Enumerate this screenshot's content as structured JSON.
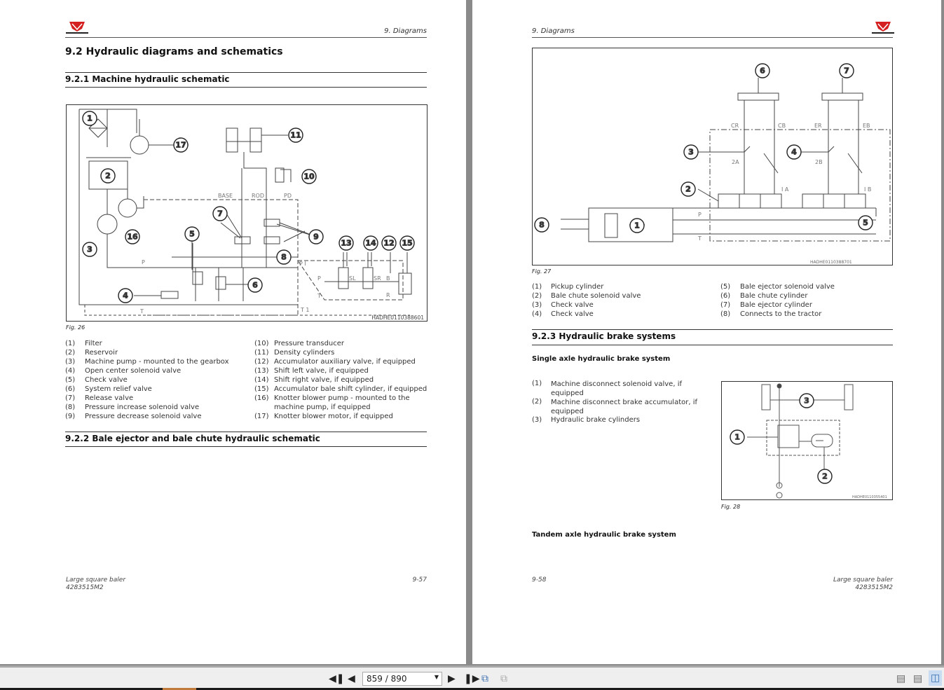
{
  "left_page": {
    "header": "9. Diagrams",
    "title": "9.2   Hydraulic diagrams and schematics",
    "section1": "9.2.1  Machine hydraulic schematic",
    "fig_caption": "Fig. 26",
    "fig_code": "HADHE0110388601",
    "callouts": [
      "1",
      "2",
      "3",
      "4",
      "5",
      "6",
      "7",
      "8",
      "9",
      "10",
      "11",
      "12",
      "13",
      "14",
      "15",
      "16",
      "17"
    ],
    "diagram_labels": {
      "base": "BASE",
      "rod": "ROD",
      "pd": "PD",
      "p": "P",
      "pi": "P I",
      "t": "T",
      "ti": "T 1",
      "sl": "SL",
      "sr": "SR",
      "b": "B",
      "r": "R",
      "p2": "P",
      "t2": "T"
    },
    "legend_left": [
      {
        "n": "(1)",
        "t": "Filter"
      },
      {
        "n": "(2)",
        "t": "Reservoir"
      },
      {
        "n": "(3)",
        "t": "Machine pump - mounted to the gearbox"
      },
      {
        "n": "(4)",
        "t": "Open center solenoid valve"
      },
      {
        "n": "(5)",
        "t": "Check valve"
      },
      {
        "n": "(6)",
        "t": "System relief valve"
      },
      {
        "n": "(7)",
        "t": "Release valve"
      },
      {
        "n": "(8)",
        "t": "Pressure increase solenoid valve"
      },
      {
        "n": "(9)",
        "t": "Pressure decrease solenoid valve"
      }
    ],
    "legend_right": [
      {
        "n": "(10)",
        "t": "Pressure transducer"
      },
      {
        "n": "(11)",
        "t": "Density cylinders"
      },
      {
        "n": "(12)",
        "t": "Accumulator auxiliary valve, if equipped"
      },
      {
        "n": "(13)",
        "t": "Shift left valve, if equipped"
      },
      {
        "n": "(14)",
        "t": "Shift right valve, if equipped"
      },
      {
        "n": "(15)",
        "t": "Accumulator bale shift cylinder, if equipped"
      },
      {
        "n": "(16)",
        "t": "Knotter blower pump - mounted to the"
      },
      {
        "n": "",
        "t": "machine pump, if equipped"
      },
      {
        "n": "(17)",
        "t": "Knotter blower motor, if equipped"
      }
    ],
    "section2": "9.2.2  Bale ejector and bale chute hydraulic schematic",
    "footer_title": "Large square baler",
    "footer_code": "4283515M2",
    "page_number": "9-57"
  },
  "right_page": {
    "header": "9. Diagrams",
    "fig27_caption": "Fig. 27",
    "fig27_code": "HADHE0110388701",
    "fig27_callouts": [
      "1",
      "2",
      "3",
      "4",
      "5",
      "6",
      "7",
      "8"
    ],
    "fig27_labels": {
      "cr": "CR",
      "cb": "CB",
      "er": "ER",
      "eb": "EB",
      "a2": "2A",
      "b2": "2B",
      "ia": "I A",
      "ib": "I B",
      "p": "P",
      "t": "T"
    },
    "legend_left": [
      {
        "n": "(1)",
        "t": "Pickup cylinder"
      },
      {
        "n": "(2)",
        "t": "Bale chute solenoid valve"
      },
      {
        "n": "(3)",
        "t": "Check valve"
      },
      {
        "n": "(4)",
        "t": "Check valve"
      }
    ],
    "legend_right": [
      {
        "n": "(5)",
        "t": "Bale ejector solenoid valve"
      },
      {
        "n": "(6)",
        "t": "Bale chute cylinder"
      },
      {
        "n": "(7)",
        "t": "Bale ejector cylinder"
      },
      {
        "n": "(8)",
        "t": "Connects to the tractor"
      }
    ],
    "section3": "9.2.3  Hydraulic brake systems",
    "single_axle": "Single axle hydraulic brake system",
    "brake_legend": [
      {
        "n": "(1)",
        "t": "Machine disconnect solenoid valve, if equipped"
      },
      {
        "n": "(2)",
        "t": "Machine disconnect brake accumulator, if equipped"
      },
      {
        "n": "(3)",
        "t": "Hydraulic brake cylinders"
      }
    ],
    "fig28_caption": "Fig. 28",
    "fig28_code": "HADHE0110355401",
    "fig28_callouts": [
      "1",
      "2",
      "3"
    ],
    "tandem_axle": "Tandem axle hydraulic brake system",
    "footer_title": "Large square baler",
    "footer_code": "4283515M2",
    "page_number": "9-58"
  },
  "toolbar": {
    "first_page_icon": "first-page-icon",
    "prev_page_icon": "prev-page-icon",
    "page_value": "859 / 890",
    "next_page_icon": "next-page-icon",
    "last_page_icon": "last-page-icon",
    "view_modes": [
      "single-page",
      "continuous",
      "two-page"
    ],
    "active_view_mode": "two-page"
  },
  "colors": {
    "logo_red": "#d42020",
    "accent_orange": "#c07a3a",
    "view_active": "#c9dcf2"
  }
}
